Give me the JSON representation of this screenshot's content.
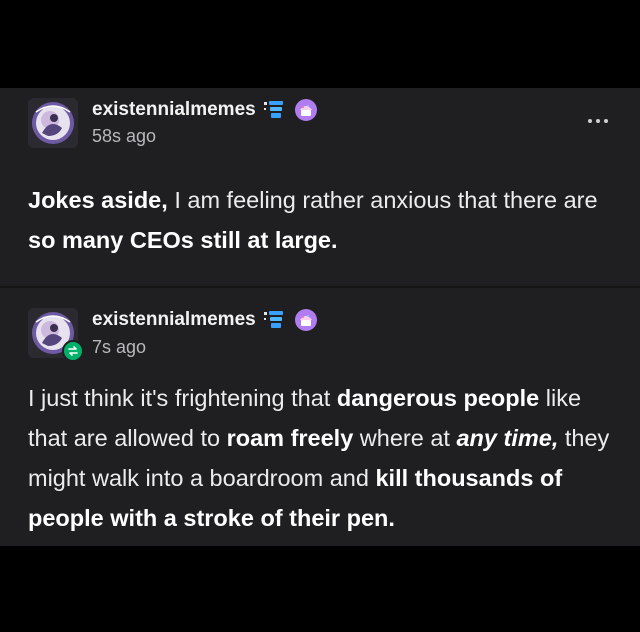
{
  "posts": [
    {
      "username": "existennialmemes",
      "timestamp": "58s ago",
      "segments": [
        {
          "text": "Jokes aside,",
          "bold": true
        },
        {
          "text": " I am feeling rather anxious that there are "
        },
        {
          "text": "so many CEOs still at large.",
          "bold": true
        }
      ]
    },
    {
      "username": "existennialmemes",
      "timestamp": "7s ago",
      "segments": [
        {
          "text": "I just think it's frightening that "
        },
        {
          "text": "dangerous people",
          "bold": true
        },
        {
          "text": " like that are allowed to "
        },
        {
          "text": "roam freely",
          "bold": true
        },
        {
          "text": " where at "
        },
        {
          "text": "any time,",
          "italic": true
        },
        {
          "text": " they might walk into a boardroom and "
        },
        {
          "text": "kill thousands of people with a stroke of their pen.",
          "bold": true
        }
      ]
    }
  ],
  "icons": {
    "more": "more-options-icon",
    "cups": "stacked-cups-badge-icon",
    "cake": "cupcake-badge-icon",
    "reblog": "reblog-icon"
  },
  "colors": {
    "background": "#000000",
    "card": "#1f1f21",
    "text": "#ececec",
    "secondary_text": "#b8b8bc",
    "reblog_green": "#00b16a",
    "badge_purple": "#b07cf0",
    "badge_blue": "#3aa0ff"
  }
}
